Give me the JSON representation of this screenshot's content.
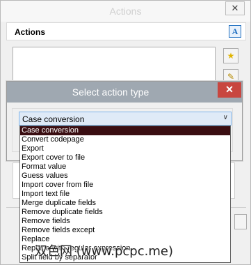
{
  "background_window": {
    "title": "Actions",
    "close_symbol": "✕",
    "section_label": "Actions",
    "font_icon_text": "A"
  },
  "dialog": {
    "title": "Select action type",
    "close_symbol": "✕",
    "combo_value": "Case conversion",
    "options": [
      "Case conversion",
      "Convert codepage",
      "Export",
      "Export cover to file",
      "Format value",
      "Guess values",
      "Import cover from file",
      "Import text file",
      "Merge duplicate fields",
      "Remove duplicate fields",
      "Remove fields",
      "Remove fields except",
      "Replace",
      "Replace with regular expression",
      "Split field by separator"
    ],
    "selected_index": 0
  },
  "watermark": "双色网 (www.pcpc.me)",
  "colors": {
    "selection": "#3a0e12",
    "dialog_title": "#9fa8b1",
    "close_red": "#c8463f",
    "combo_bg": "#dfeaf7"
  },
  "icons": [
    "close-icon",
    "font-icon",
    "star-icon",
    "edit-icon",
    "dropdown-arrow-icon"
  ]
}
